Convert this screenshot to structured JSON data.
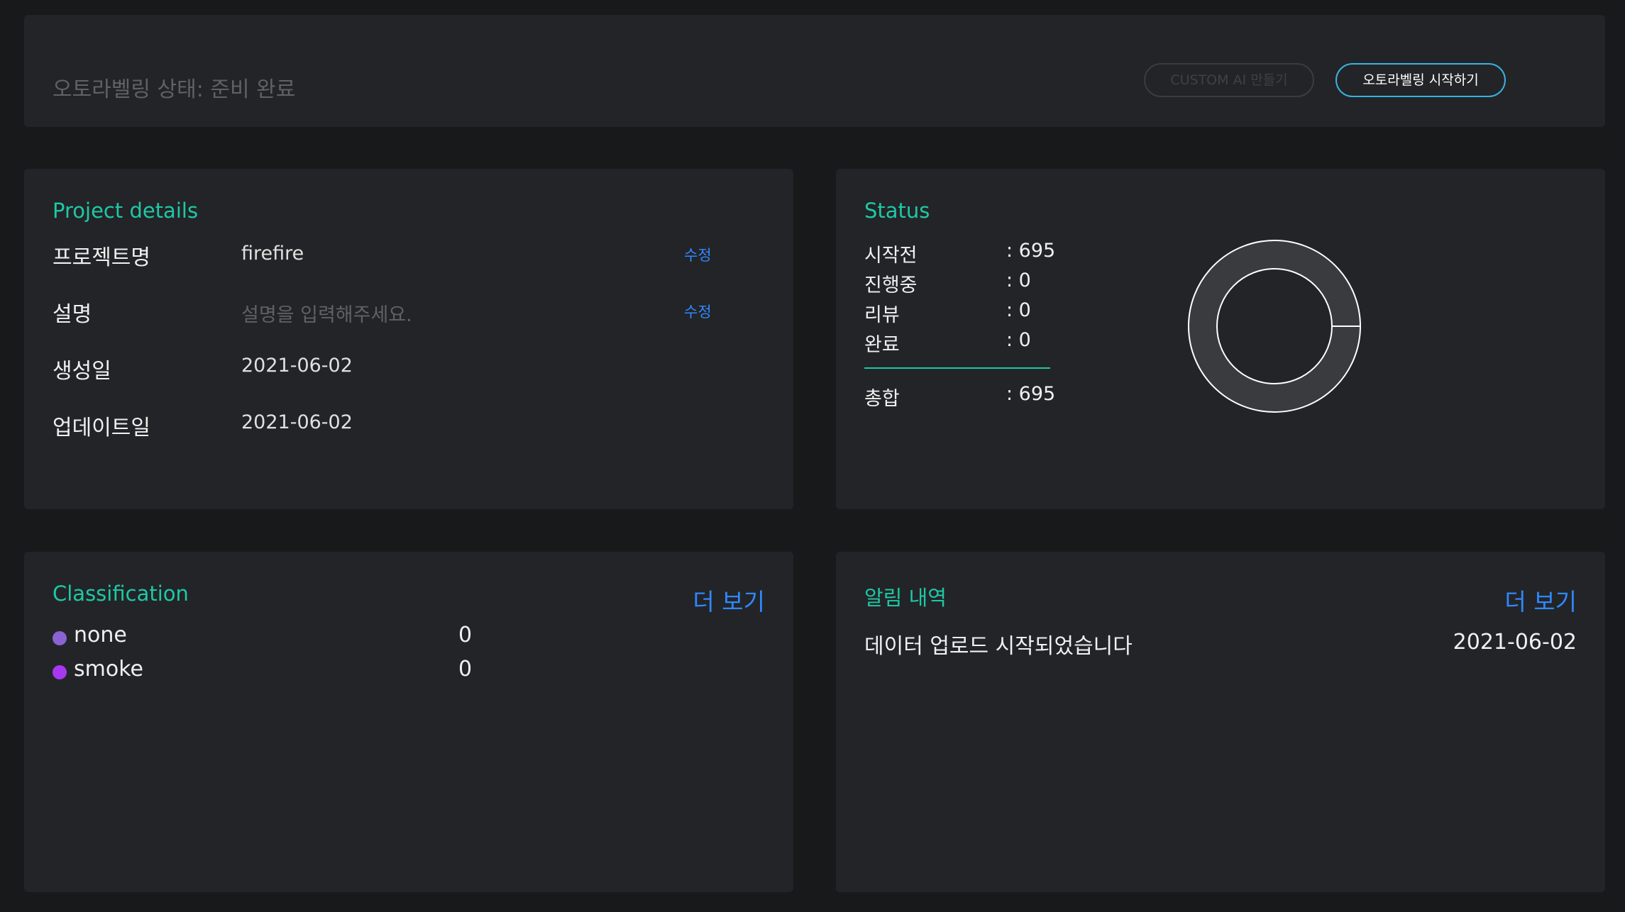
{
  "top_bar": {
    "status_text": "오토라벨링 상태: 준비 완료",
    "custom_ai_label": "CUSTOM AI 만들기",
    "start_autolabel_label": "오토라벨링 시작하기"
  },
  "project_details": {
    "title": "Project details",
    "fields": [
      {
        "label": "프로젝트명",
        "value": "firefire",
        "edit": "수정"
      },
      {
        "label": "설명",
        "placeholder": "설명을 입력해주세요.",
        "edit": "수정"
      },
      {
        "label": "생성일",
        "value": "2021-06-02"
      },
      {
        "label": "업데이트일",
        "value": "2021-06-02"
      }
    ]
  },
  "status": {
    "title": "Status",
    "rows": [
      {
        "label": "시작전",
        "value": ": 695"
      },
      {
        "label": "진행중",
        "value": ": 0"
      },
      {
        "label": "리뷰",
        "value": ": 0"
      },
      {
        "label": "완료",
        "value": ": 0"
      }
    ],
    "total": {
      "label": "총합",
      "value": ": 695"
    },
    "donut": {
      "counts": {
        "not_started": 695,
        "in_progress": 0,
        "review": 0,
        "done": 0
      },
      "ring_color": "#3a3b3e",
      "stroke_color": "#ffffff"
    }
  },
  "classification": {
    "title": "Classification",
    "more_label": "더 보기",
    "items": [
      {
        "name": "none",
        "count": "0",
        "color": "#8a63d2"
      },
      {
        "name": "smoke",
        "count": "0",
        "color": "#a838ef"
      }
    ]
  },
  "notices": {
    "title": "알림 내역",
    "more_label": "더 보기",
    "items": [
      {
        "message": "데이터 업로드 시작되었습니다",
        "date": "2021-06-02"
      }
    ]
  },
  "colors": {
    "accent_teal": "#1ec8a6",
    "link_blue": "#2f88ff",
    "button_border": "#38b3e0"
  }
}
